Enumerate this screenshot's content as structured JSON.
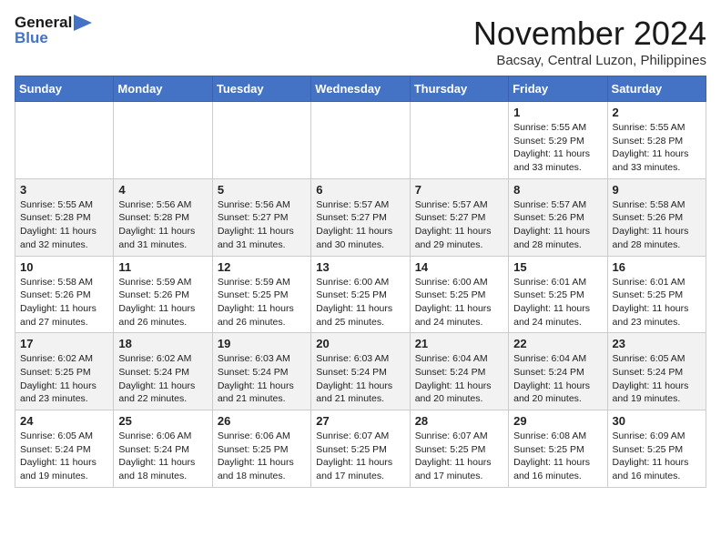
{
  "header": {
    "logo_line1": "General",
    "logo_line2": "Blue",
    "month": "November 2024",
    "location": "Bacsay, Central Luzon, Philippines"
  },
  "weekdays": [
    "Sunday",
    "Monday",
    "Tuesday",
    "Wednesday",
    "Thursday",
    "Friday",
    "Saturday"
  ],
  "weeks": [
    [
      {
        "day": "",
        "info": ""
      },
      {
        "day": "",
        "info": ""
      },
      {
        "day": "",
        "info": ""
      },
      {
        "day": "",
        "info": ""
      },
      {
        "day": "",
        "info": ""
      },
      {
        "day": "1",
        "info": "Sunrise: 5:55 AM\nSunset: 5:29 PM\nDaylight: 11 hours\nand 33 minutes."
      },
      {
        "day": "2",
        "info": "Sunrise: 5:55 AM\nSunset: 5:28 PM\nDaylight: 11 hours\nand 33 minutes."
      }
    ],
    [
      {
        "day": "3",
        "info": "Sunrise: 5:55 AM\nSunset: 5:28 PM\nDaylight: 11 hours\nand 32 minutes."
      },
      {
        "day": "4",
        "info": "Sunrise: 5:56 AM\nSunset: 5:28 PM\nDaylight: 11 hours\nand 31 minutes."
      },
      {
        "day": "5",
        "info": "Sunrise: 5:56 AM\nSunset: 5:27 PM\nDaylight: 11 hours\nand 31 minutes."
      },
      {
        "day": "6",
        "info": "Sunrise: 5:57 AM\nSunset: 5:27 PM\nDaylight: 11 hours\nand 30 minutes."
      },
      {
        "day": "7",
        "info": "Sunrise: 5:57 AM\nSunset: 5:27 PM\nDaylight: 11 hours\nand 29 minutes."
      },
      {
        "day": "8",
        "info": "Sunrise: 5:57 AM\nSunset: 5:26 PM\nDaylight: 11 hours\nand 28 minutes."
      },
      {
        "day": "9",
        "info": "Sunrise: 5:58 AM\nSunset: 5:26 PM\nDaylight: 11 hours\nand 28 minutes."
      }
    ],
    [
      {
        "day": "10",
        "info": "Sunrise: 5:58 AM\nSunset: 5:26 PM\nDaylight: 11 hours\nand 27 minutes."
      },
      {
        "day": "11",
        "info": "Sunrise: 5:59 AM\nSunset: 5:26 PM\nDaylight: 11 hours\nand 26 minutes."
      },
      {
        "day": "12",
        "info": "Sunrise: 5:59 AM\nSunset: 5:25 PM\nDaylight: 11 hours\nand 26 minutes."
      },
      {
        "day": "13",
        "info": "Sunrise: 6:00 AM\nSunset: 5:25 PM\nDaylight: 11 hours\nand 25 minutes."
      },
      {
        "day": "14",
        "info": "Sunrise: 6:00 AM\nSunset: 5:25 PM\nDaylight: 11 hours\nand 24 minutes."
      },
      {
        "day": "15",
        "info": "Sunrise: 6:01 AM\nSunset: 5:25 PM\nDaylight: 11 hours\nand 24 minutes."
      },
      {
        "day": "16",
        "info": "Sunrise: 6:01 AM\nSunset: 5:25 PM\nDaylight: 11 hours\nand 23 minutes."
      }
    ],
    [
      {
        "day": "17",
        "info": "Sunrise: 6:02 AM\nSunset: 5:25 PM\nDaylight: 11 hours\nand 23 minutes."
      },
      {
        "day": "18",
        "info": "Sunrise: 6:02 AM\nSunset: 5:24 PM\nDaylight: 11 hours\nand 22 minutes."
      },
      {
        "day": "19",
        "info": "Sunrise: 6:03 AM\nSunset: 5:24 PM\nDaylight: 11 hours\nand 21 minutes."
      },
      {
        "day": "20",
        "info": "Sunrise: 6:03 AM\nSunset: 5:24 PM\nDaylight: 11 hours\nand 21 minutes."
      },
      {
        "day": "21",
        "info": "Sunrise: 6:04 AM\nSunset: 5:24 PM\nDaylight: 11 hours\nand 20 minutes."
      },
      {
        "day": "22",
        "info": "Sunrise: 6:04 AM\nSunset: 5:24 PM\nDaylight: 11 hours\nand 20 minutes."
      },
      {
        "day": "23",
        "info": "Sunrise: 6:05 AM\nSunset: 5:24 PM\nDaylight: 11 hours\nand 19 minutes."
      }
    ],
    [
      {
        "day": "24",
        "info": "Sunrise: 6:05 AM\nSunset: 5:24 PM\nDaylight: 11 hours\nand 19 minutes."
      },
      {
        "day": "25",
        "info": "Sunrise: 6:06 AM\nSunset: 5:24 PM\nDaylight: 11 hours\nand 18 minutes."
      },
      {
        "day": "26",
        "info": "Sunrise: 6:06 AM\nSunset: 5:25 PM\nDaylight: 11 hours\nand 18 minutes."
      },
      {
        "day": "27",
        "info": "Sunrise: 6:07 AM\nSunset: 5:25 PM\nDaylight: 11 hours\nand 17 minutes."
      },
      {
        "day": "28",
        "info": "Sunrise: 6:07 AM\nSunset: 5:25 PM\nDaylight: 11 hours\nand 17 minutes."
      },
      {
        "day": "29",
        "info": "Sunrise: 6:08 AM\nSunset: 5:25 PM\nDaylight: 11 hours\nand 16 minutes."
      },
      {
        "day": "30",
        "info": "Sunrise: 6:09 AM\nSunset: 5:25 PM\nDaylight: 11 hours\nand 16 minutes."
      }
    ]
  ]
}
